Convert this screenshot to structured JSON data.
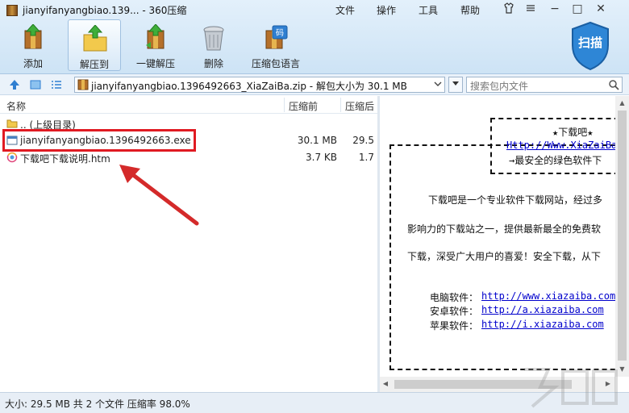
{
  "window": {
    "title": "jianyifanyangbiao.139... - 360压缩",
    "menu": [
      "文件",
      "操作",
      "工具",
      "帮助"
    ],
    "controls": {
      "minimize": "−",
      "maximize": "□",
      "close": "✕"
    }
  },
  "toolbar": {
    "items": [
      {
        "label": "添加",
        "icon": "add-archive-icon"
      },
      {
        "label": "解压到",
        "icon": "extract-to-icon",
        "active": true
      },
      {
        "label": "一键解压",
        "icon": "one-click-extract-icon"
      },
      {
        "label": "删除",
        "icon": "delete-trash-icon"
      },
      {
        "label": "压缩包语言",
        "icon": "archive-language-icon"
      }
    ],
    "scan_label": "扫描"
  },
  "address_bar": {
    "path": "jianyifanyangbiao.1396492663_XiaZaiBa.zip - 解包大小为 30.1 MB",
    "search_placeholder": "搜索包内文件"
  },
  "file_list": {
    "columns": {
      "name": "名称",
      "size": "压缩前",
      "packed": "压缩后"
    },
    "rows": [
      {
        "name": ".. (上级目录)",
        "size": "",
        "packed": "",
        "icon": "folder-icon"
      },
      {
        "name": "jianyifanyangbiao.1396492663.exe",
        "size": "30.1 MB",
        "packed": "29.5",
        "icon": "exe-file-icon"
      },
      {
        "name": "下载吧下载说明.htm",
        "size": "3.7 KB",
        "packed": "1.7",
        "icon": "htm-file-icon"
      }
    ]
  },
  "preview": {
    "box_title": "★下载吧★",
    "box_url": "Http://Www.XiaZaiBa",
    "box_slogan": "→最安全的绿色软件下",
    "para1": "下载吧是一个专业软件下载网站，经过多",
    "para2": "影响力的下载站之一，提供最新最全的免费软",
    "para3": "下载，深受广大用户的喜爱！安全下载，从下",
    "links": [
      {
        "label": "电脑软件：",
        "url": "http://www.xiazaiba.com"
      },
      {
        "label": "安卓软件：",
        "url": "http://a.xiazaiba.com"
      },
      {
        "label": "苹果软件：",
        "url": "http://i.xiazaiba.com"
      }
    ]
  },
  "status_bar": {
    "text": "大小: 29.5 MB 共 2 个文件 压缩率 98.0%"
  },
  "colors": {
    "highlight": "#e01a22",
    "arrow": "#d42a2a",
    "accent": "#2f7fd1"
  }
}
